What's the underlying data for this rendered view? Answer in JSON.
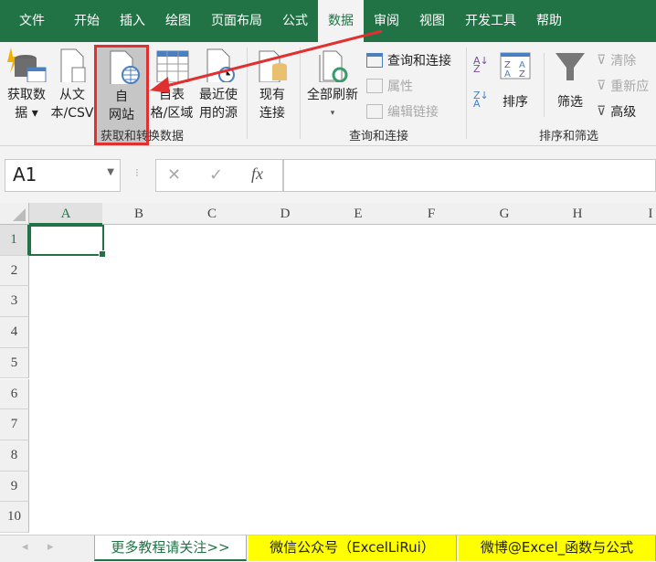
{
  "tabs": [
    "文件",
    "开始",
    "插入",
    "绘图",
    "页面布局",
    "公式",
    "数据",
    "审阅",
    "视图",
    "开发工具",
    "帮助"
  ],
  "active_tab": "数据",
  "ribbon": {
    "get_data": [
      "获取数",
      "据"
    ],
    "from_text": [
      "从文",
      "本/CSV"
    ],
    "from_web": [
      "自",
      "网站"
    ],
    "from_table": [
      "自表",
      "格/区域"
    ],
    "recent": [
      "最近使",
      "用的源"
    ],
    "existing": [
      "现有",
      "连接"
    ],
    "group1": "获取和转换数据",
    "refresh_all": "全部刷新",
    "queries": "查询和连接",
    "properties": "属性",
    "edit_links": "编辑链接",
    "group2": "查询和连接",
    "sort": "排序",
    "filter": "筛选",
    "clear": "清除",
    "reapply": "重新应",
    "advanced": "高级",
    "group3": "排序和筛选"
  },
  "formula_bar": {
    "name_box": "A1",
    "cancel": "✕",
    "enter": "✓",
    "fx": "fx",
    "value": ""
  },
  "columns": [
    "A",
    "B",
    "C",
    "D",
    "E",
    "F",
    "G",
    "H",
    "I"
  ],
  "rows": [
    "1",
    "2",
    "3",
    "4",
    "5",
    "6",
    "7",
    "8",
    "9",
    "10"
  ],
  "sheets": [
    "更多教程请关注>>",
    "微信公众号（ExcelLiRui）",
    "微博@Excel_函数与公式"
  ],
  "colors": {
    "brand": "#217346",
    "highlight": "#ffff00",
    "annotation": "#e03030"
  }
}
